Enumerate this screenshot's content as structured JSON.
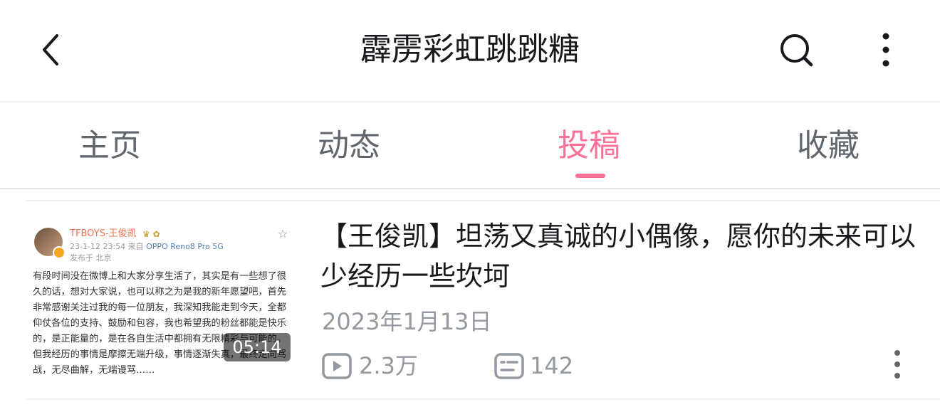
{
  "header": {
    "title": "霹雳彩虹跳跳糖",
    "back_icon": "chevron-left-icon",
    "search_icon": "search-icon",
    "more_icon": "more-vertical-icon"
  },
  "tabs": [
    {
      "label": "主页",
      "active": false
    },
    {
      "label": "动态",
      "active": false
    },
    {
      "label": "投稿",
      "active": true
    },
    {
      "label": "收藏",
      "active": false
    }
  ],
  "colors": {
    "accent": "#fb7299",
    "text_primary": "#18191c",
    "text_secondary": "#61666d",
    "text_meta": "#9499a0"
  },
  "videos": [
    {
      "title": "【王俊凯】坦荡又真诚的小偶像，愿你的未来可以少经历一些坎坷",
      "date": "2023年1月13日",
      "views": "2.3万",
      "danmaku": "142",
      "duration": "05:14",
      "thumbnail": {
        "username": "TFBOYS-王俊凯",
        "meta_time": "23-1-12 23:54",
        "meta_from": "来自",
        "meta_device": "OPPO Reno8 Pro 5G",
        "location": "发布于 北京",
        "text": "有段时间没在微博上和大家分享生活了，其实是有一些想了很久的话，想对大家说，也可以称之为是我的新年愿望吧，首先非常感谢关注过我的每一位朋友，我深知我能走到今天，全都仰仗各位的支持、鼓励和包容，我也希望我的粉丝都能是快乐的，是正能量的，是在各自生活中都拥有无限精彩与可能的。但我经历的事情是摩擦无端升级，事情逐渐失真，最终走向骂战，无尽曲解，无端谩骂……"
      }
    }
  ]
}
